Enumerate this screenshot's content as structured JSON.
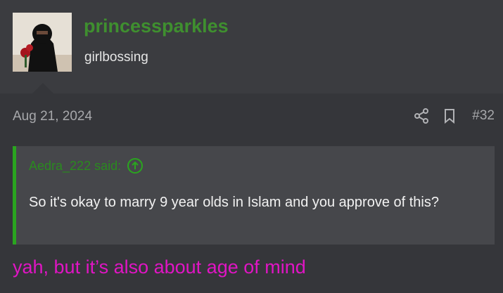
{
  "user": {
    "name": "princessparkles",
    "title": "girlbossing"
  },
  "post": {
    "date": "Aug 21, 2024",
    "number": "#32"
  },
  "quote": {
    "author_said": "Aedra_222 said:",
    "text": "So it's okay to marry 9 year olds in Islam and you approve of this?"
  },
  "reply": {
    "text": "yah, but it’s also about age of mind"
  },
  "colors": {
    "username": "#3f8f2f",
    "quote_bar": "#2aa51f",
    "reply_text": "#e015c4"
  },
  "icons": [
    "share-icon",
    "bookmark-icon",
    "arrow-up-circle-icon"
  ]
}
